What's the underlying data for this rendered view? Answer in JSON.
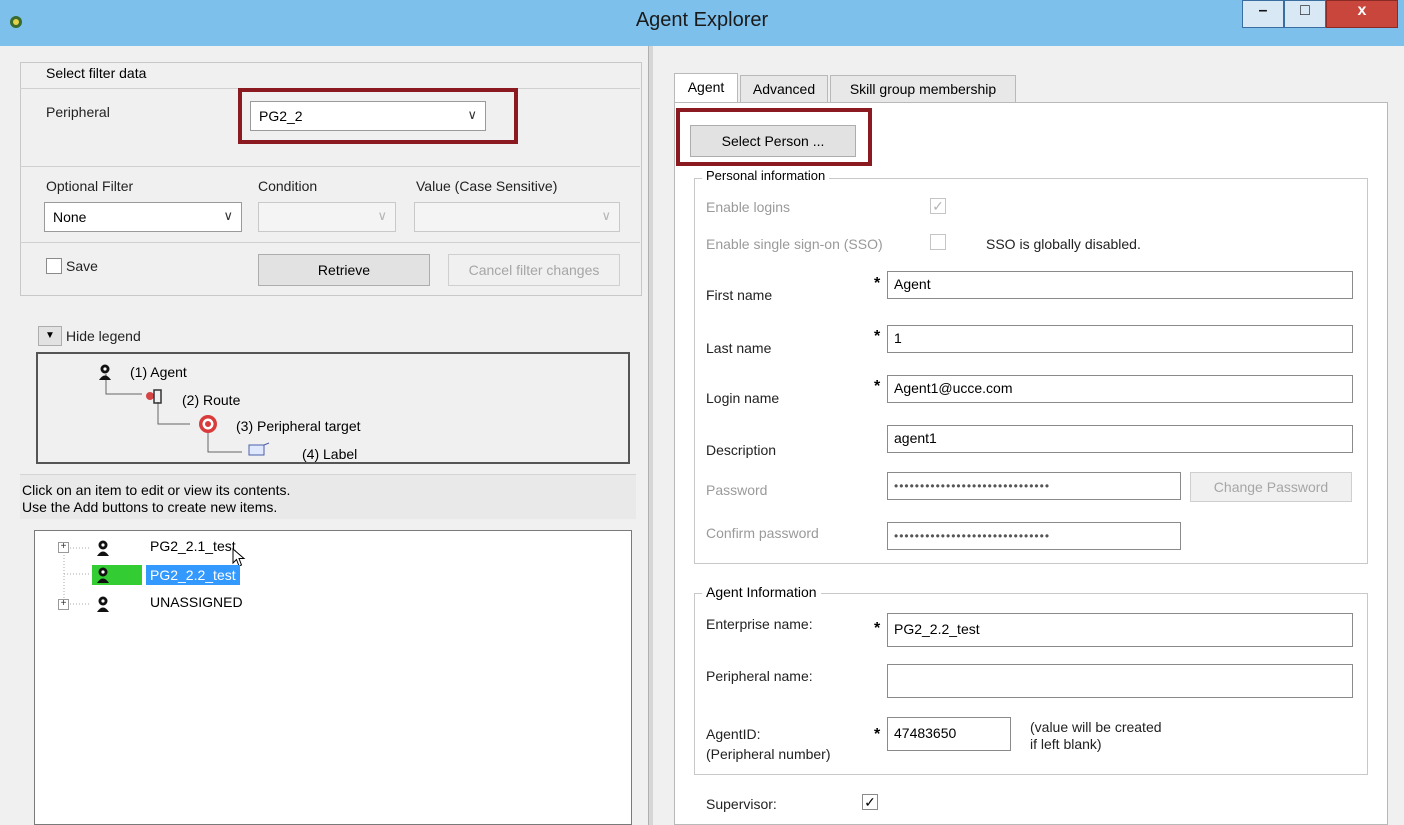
{
  "window": {
    "title": "Agent Explorer",
    "minimize": "–",
    "maximize": "□",
    "close": "x"
  },
  "filter": {
    "group_title": "Select filter data",
    "peripheral_label": "Peripheral",
    "peripheral_value": "PG2_2",
    "optional_filter_label": "Optional Filter",
    "optional_filter_value": "None",
    "condition_label": "Condition",
    "value_label": "Value (Case Sensitive)",
    "save_label": "Save",
    "retrieve_label": "Retrieve",
    "cancel_label": "Cancel filter changes"
  },
  "legend": {
    "toggle_label": "Hide legend",
    "items": [
      "(1) Agent",
      "(2) Route",
      "(3) Peripheral target",
      "(4) Label"
    ]
  },
  "info": {
    "line1": "Click on an item to edit or view its contents.",
    "line2": "Use the Add buttons to create new items."
  },
  "tree": {
    "items": [
      "PG2_2.1_test",
      "PG2_2.2_test",
      "UNASSIGNED"
    ]
  },
  "tabs": [
    "Agent",
    "Advanced",
    "Skill group membership"
  ],
  "select_person_label": "Select Person ...",
  "personal": {
    "group_title": "Personal information",
    "enable_logins_label": "Enable logins",
    "sso_label": "Enable single sign-on (SSO)",
    "sso_note": "SSO is globally disabled.",
    "first_name_label": "First name",
    "first_name_value": "Agent",
    "last_name_label": "Last name",
    "last_name_value": "1",
    "login_name_label": "Login name",
    "login_name_value": "Agent1@ucce.com",
    "description_label": "Description",
    "description_value": "agent1",
    "password_label": "Password",
    "password_value": "••••••••••••••••••••••••••••••",
    "confirm_password_label": "Confirm password",
    "confirm_password_value": "••••••••••••••••••••••••••••••",
    "change_password_label": "Change Password"
  },
  "agent_info": {
    "group_title": "Agent Information",
    "enterprise_name_label": "Enterprise name:",
    "enterprise_name_value": "PG2_2.2_test",
    "peripheral_name_label": "Peripheral name:",
    "peripheral_name_value": "",
    "agent_id_label": "AgentID:",
    "agent_id_sublabel": "(Peripheral number)",
    "agent_id_value": "47483650",
    "agent_id_note1": "(value will be created",
    "agent_id_note2": "if left blank)"
  },
  "supervisor_label": "Supervisor:",
  "required_mark": "*",
  "colors": {
    "titlebar": "#7ec0ec",
    "highlight": "#8a1a1f",
    "tree_selected": "#3399ff",
    "tree_icon_bg": "#33cc33"
  }
}
